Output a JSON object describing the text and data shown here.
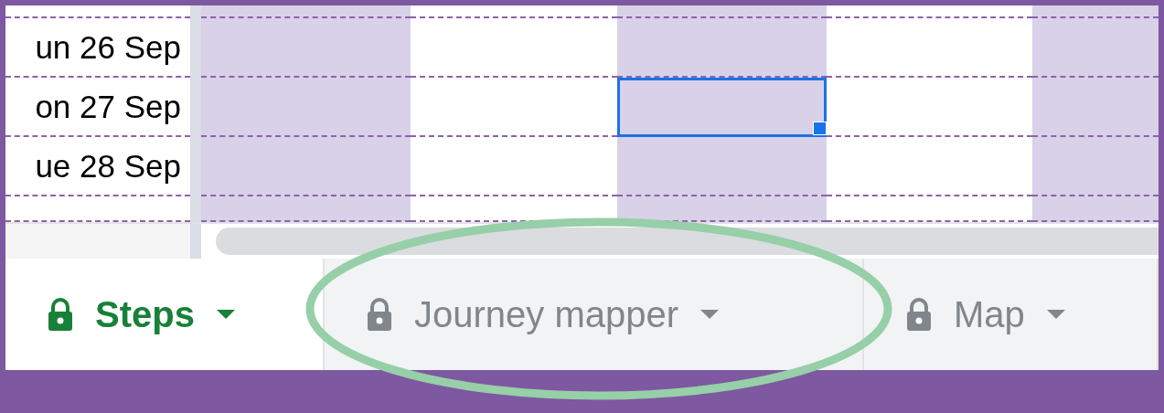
{
  "columns": [
    {
      "color": "#d9d1e8"
    },
    {
      "color": "#ffffff"
    },
    {
      "color": "#d9d1e8"
    },
    {
      "color": "#ffffff"
    },
    {
      "color": "#d9d1e8"
    }
  ],
  "rows": [
    {
      "label": "un 26 Sep",
      "cells": [
        {
          "selected": false
        },
        {
          "selected": false
        },
        {
          "selected": false
        },
        {
          "selected": false
        },
        {
          "selected": false
        }
      ]
    },
    {
      "label": "on 27 Sep",
      "cells": [
        {
          "selected": false
        },
        {
          "selected": false
        },
        {
          "selected": true
        },
        {
          "selected": false
        },
        {
          "selected": false
        }
      ]
    },
    {
      "label": "ue 28 Sep",
      "cells": [
        {
          "selected": false
        },
        {
          "selected": false
        },
        {
          "selected": false
        },
        {
          "selected": false
        },
        {
          "selected": false
        }
      ]
    }
  ],
  "sheet_tabs": [
    {
      "label": "Steps",
      "selected": true
    },
    {
      "label": "Journey mapper",
      "selected": false,
      "highlighted": true
    },
    {
      "label": "Map",
      "selected": false
    }
  ]
}
